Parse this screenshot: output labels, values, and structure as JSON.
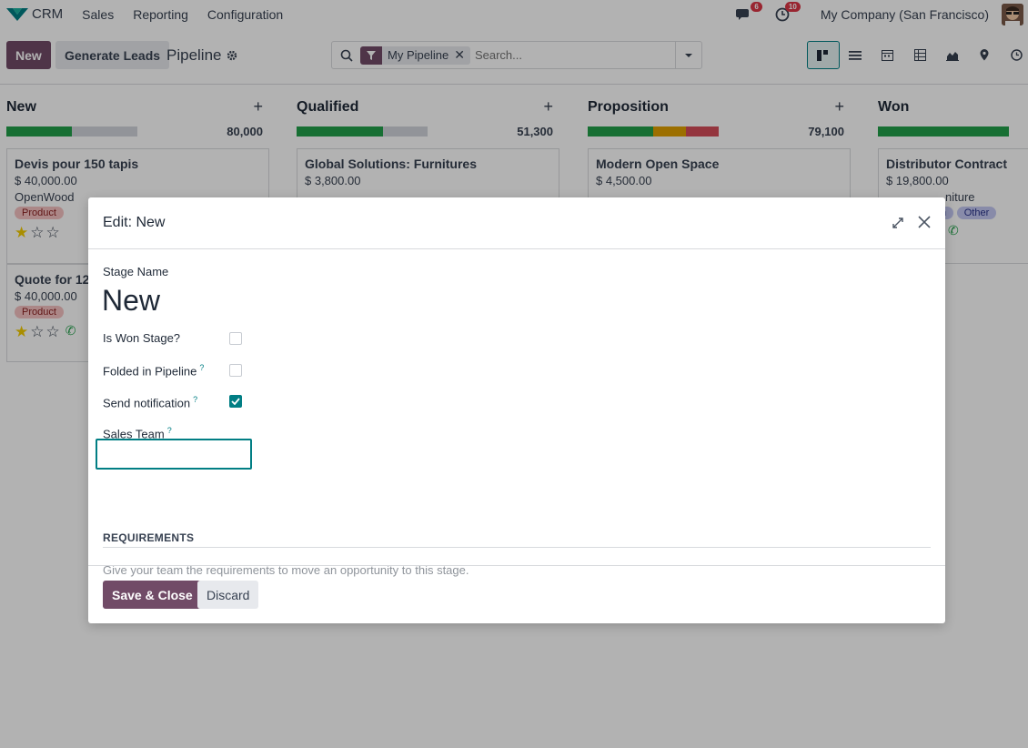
{
  "navbar": {
    "app_name": "CRM",
    "menu": [
      "Sales",
      "Reporting",
      "Configuration"
    ],
    "messages_count": "6",
    "activities_count": "10",
    "company": "My Company (San Francisco)"
  },
  "control": {
    "new_label": "New",
    "generate_leads_label": "Generate Leads",
    "breadcrumb": "Pipeline",
    "facet_label": "My Pipeline",
    "search_placeholder": "Search..."
  },
  "columns": [
    {
      "title": "New",
      "total": "80,000",
      "progress": [
        {
          "color": "#21a04a",
          "pct": 50
        }
      ],
      "cards": [
        {
          "title": "Devis pour 150 tapis",
          "amount": "$ 40,000.00",
          "partner": "OpenWood",
          "tag": "Product"
        },
        {
          "title": "Quote for 12",
          "amount": "$ 40,000.00",
          "tag": "Product"
        }
      ]
    },
    {
      "title": "Qualified",
      "total": "51,300",
      "progress": [
        {
          "color": "#21a04a",
          "pct": 66
        }
      ],
      "cards": [
        {
          "title": "Global Solutions: Furnitures",
          "amount": "$ 3,800.00"
        }
      ]
    },
    {
      "title": "Proposition",
      "total": "79,100",
      "progress": [
        {
          "color": "#21a04a",
          "pct": 50
        },
        {
          "color": "#e0a000",
          "pct": 25
        },
        {
          "color": "#d44c59",
          "pct": 25
        }
      ],
      "cards": [
        {
          "title": "Modern Open Space",
          "amount": "$ 4,500.00"
        }
      ]
    },
    {
      "title": "Won",
      "total": "",
      "progress": [
        {
          "color": "#21a04a",
          "pct": 100
        }
      ],
      "cards": [
        {
          "title": "Distributor Contract",
          "amount": "$ 19,800.00",
          "partner": "niture",
          "tag1": "n",
          "tag2": "Other"
        }
      ]
    }
  ],
  "modal": {
    "title": "Edit: New",
    "stage_name_label": "Stage Name",
    "stage_name_value": "New",
    "is_won_label": "Is Won Stage?",
    "folded_label": "Folded in Pipeline",
    "send_notification_label": "Send notification",
    "sales_team_label": "Sales Team",
    "help_mark": "?",
    "requirements_title": "REQUIREMENTS",
    "requirements_placeholder": "Give your team the requirements to move an opportunity to this stage.",
    "save_label": "Save & Close",
    "discard_label": "Discard",
    "is_won_checked": false,
    "folded_checked": false,
    "send_notification_checked": true
  },
  "colors": {
    "brand": "#714b67",
    "accent": "#017e84"
  }
}
